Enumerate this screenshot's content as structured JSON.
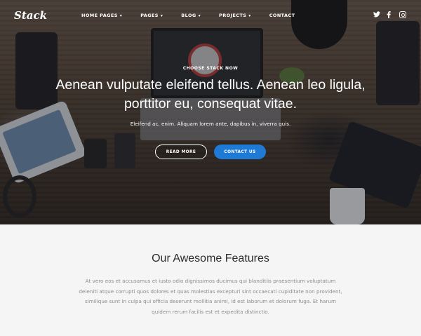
{
  "brand": {
    "logo": "Stack"
  },
  "nav": {
    "items": [
      {
        "label": "HOME PAGES",
        "has_dropdown": true
      },
      {
        "label": "PAGES",
        "has_dropdown": true
      },
      {
        "label": "BLOG",
        "has_dropdown": true
      },
      {
        "label": "PROJECTS",
        "has_dropdown": true
      },
      {
        "label": "CONTACT",
        "has_dropdown": false
      }
    ],
    "chevron": "▾",
    "social": [
      "twitter-icon",
      "facebook-icon",
      "instagram-icon"
    ]
  },
  "hero": {
    "kicker": "CHOOSE STACK NOW",
    "headline": "Aenean vulputate eleifend tellus. Aenean leo ligula, porttitor eu, consequat vitae.",
    "subtext": "Eleifend ac, enim. Aliquam lorem ante, dapibus in, viverra quis.",
    "primary_button": "READ MORE",
    "secondary_button": "CONTACT US"
  },
  "features": {
    "title": "Our Awesome Features",
    "text": "At vero eos et accusamus et iusto odio dignissimos ducimus qui blanditiis praesentium voluptatum deleniti atque corrupti quos dolores et quas molestias excepturi sint occaecati cupiditate non provident, similique sunt in culpa qui officia deserunt mollitia animi, id est laborum et dolorum fuga. Et harum quidem rerum facilis est et expedita distinctio."
  },
  "colors": {
    "accent": "#1f7ad6",
    "features_bg": "#f5f5f5",
    "text_muted": "#8c8c8c"
  }
}
